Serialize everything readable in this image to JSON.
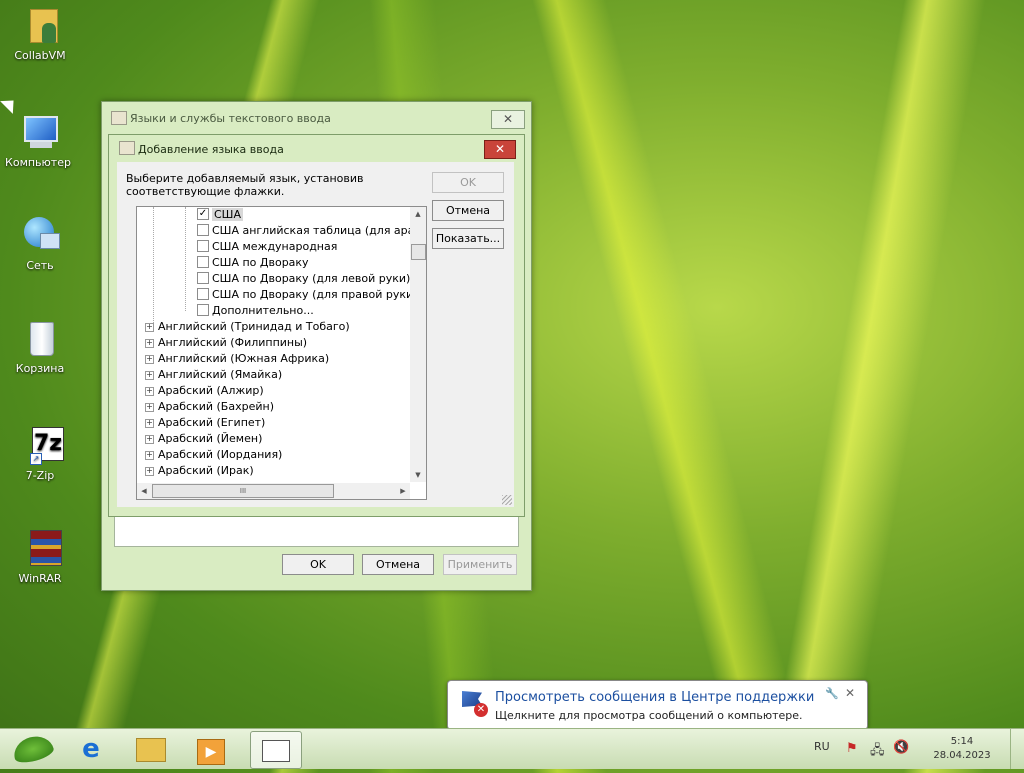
{
  "desktop_icons": [
    {
      "label": "CollabVM"
    },
    {
      "label": "Компьютер"
    },
    {
      "label": "Сеть"
    },
    {
      "label": "Корзина"
    },
    {
      "label": "7-Zip"
    },
    {
      "label": "WinRAR"
    }
  ],
  "outer_window": {
    "title": "Языки и службы текстового ввода",
    "buttons": {
      "ok": "OK",
      "cancel": "Отмена",
      "apply": "Применить"
    }
  },
  "dialog": {
    "title": "Добавление языка ввода",
    "instruction_line1": "Выберите добавляемый язык, установив",
    "instruction_line2": "соответствующие флажки.",
    "buttons": {
      "ok": "OK",
      "cancel": "Отмена",
      "preview": "Показать..."
    },
    "subitems": [
      {
        "label": "США",
        "checked": true
      },
      {
        "label": "США английская таблица (для арабск",
        "checked": false
      },
      {
        "label": "США международная",
        "checked": false
      },
      {
        "label": "США по Двораку",
        "checked": false
      },
      {
        "label": "США по Двораку (для левой руки)",
        "checked": false
      },
      {
        "label": "США по Двораку (для правой руки)",
        "checked": false
      },
      {
        "label": "Дополнительно...",
        "checked": false
      }
    ],
    "languages": [
      "Английский (Тринидад и Тобаго)",
      "Английский (Филиппины)",
      "Английский (Южная Африка)",
      "Английский (Ямайка)",
      "Арабский (Алжир)",
      "Арабский (Бахрейн)",
      "Арабский (Египет)",
      "Арабский (Йемен)",
      "Арабский (Иордания)",
      "Арабский (Ирак)"
    ],
    "hscroll_label": "III"
  },
  "notification": {
    "title": "Просмотреть сообщения в Центре поддержки",
    "text": "Щелкните для просмотра сообщений о компьютере."
  },
  "tray": {
    "language": "RU",
    "time": "5:14",
    "date": "28.04.2023"
  },
  "colors": {
    "accent_blue": "#1c4fa0",
    "close_red": "#c9443a"
  }
}
